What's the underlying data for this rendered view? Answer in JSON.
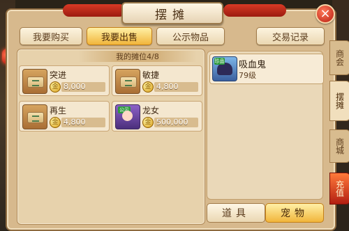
{
  "window": {
    "title": "摆摊",
    "close_icon": "×"
  },
  "tabs": [
    {
      "label": "我要购买",
      "active": false
    },
    {
      "label": "我要出售",
      "active": true
    },
    {
      "label": "公示物品",
      "active": false
    }
  ],
  "history_button": "交易记录",
  "stall": {
    "title": "我的摊位4/8",
    "slots": [
      {
        "name": "突进",
        "price": "8,000",
        "icon": "skill-book-icon"
      },
      {
        "name": "敏捷",
        "price": "4,800",
        "icon": "skill-book-icon"
      },
      {
        "name": "再生",
        "price": "4,800",
        "icon": "skill-book-icon"
      },
      {
        "name": "龙女",
        "price": "500,000",
        "icon": "pet-portrait-icon",
        "tag": "公示"
      }
    ]
  },
  "pet_list": [
    {
      "name": "吸血鬼",
      "level": "79级",
      "tag": "珍品"
    }
  ],
  "bottom_tabs": [
    {
      "label": "道具",
      "active": false
    },
    {
      "label": "宠物",
      "active": true
    }
  ],
  "side_tabs": [
    "商会",
    "摆摊",
    "商城",
    "充值"
  ],
  "coin_symbol": "金",
  "colors": {
    "accent": "#f1b53b",
    "recharge": "#b31f12"
  }
}
